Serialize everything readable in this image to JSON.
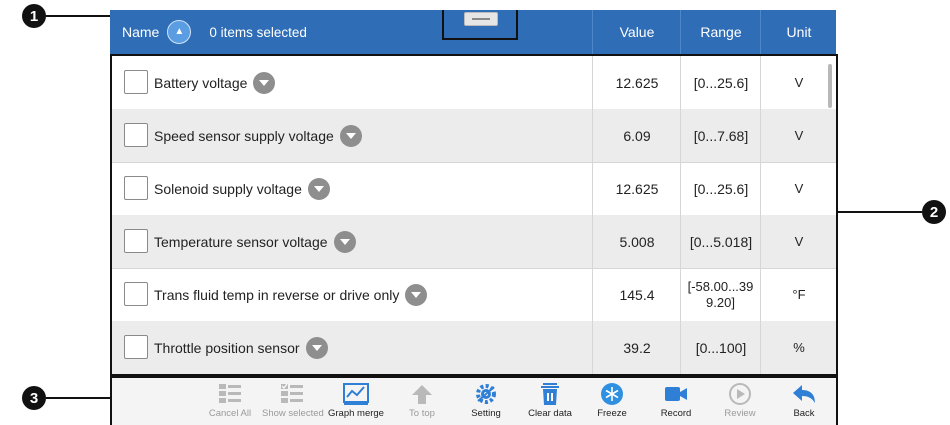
{
  "header": {
    "name_label": "Name",
    "selected_text": "0 items selected",
    "value_label": "Value",
    "range_label": "Range",
    "unit_label": "Unit"
  },
  "rows": [
    {
      "label": "Battery voltage",
      "value": "12.625",
      "range": "[0...25.6]",
      "unit": "V"
    },
    {
      "label": "Speed sensor supply voltage",
      "value": "6.09",
      "range": "[0...7.68]",
      "unit": "V"
    },
    {
      "label": "Solenoid supply voltage",
      "value": "12.625",
      "range": "[0...25.6]",
      "unit": "V"
    },
    {
      "label": "Temperature sensor voltage",
      "value": "5.008",
      "range": "[0...5.018]",
      "unit": "V"
    },
    {
      "label": "Trans fluid temp in reverse or drive only",
      "value": "145.4",
      "range": "[-58.00...399.20]",
      "unit": "°F"
    },
    {
      "label": "Throttle position sensor",
      "value": "39.2",
      "range": "[0...100]",
      "unit": "%"
    }
  ],
  "toolbar": [
    {
      "label": "Cancel All",
      "icon": "cancel-all-icon",
      "enabled": false
    },
    {
      "label": "Show selected",
      "icon": "show-selected-icon",
      "enabled": false
    },
    {
      "label": "Graph merge",
      "icon": "graph-merge-icon",
      "enabled": true
    },
    {
      "label": "To top",
      "icon": "to-top-icon",
      "enabled": false
    },
    {
      "label": "Setting",
      "icon": "setting-icon",
      "enabled": true
    },
    {
      "label": "Clear data",
      "icon": "clear-data-icon",
      "enabled": true
    },
    {
      "label": "Freeze",
      "icon": "freeze-icon",
      "enabled": true
    },
    {
      "label": "Record",
      "icon": "record-icon",
      "enabled": true
    },
    {
      "label": "Review",
      "icon": "review-icon",
      "enabled": false
    },
    {
      "label": "Back",
      "icon": "back-icon",
      "enabled": true
    }
  ],
  "callouts": [
    "1",
    "2",
    "3"
  ],
  "colors": {
    "header": "#2f6db6",
    "accent": "#2f7fd6",
    "row_alt": "#ececec"
  }
}
